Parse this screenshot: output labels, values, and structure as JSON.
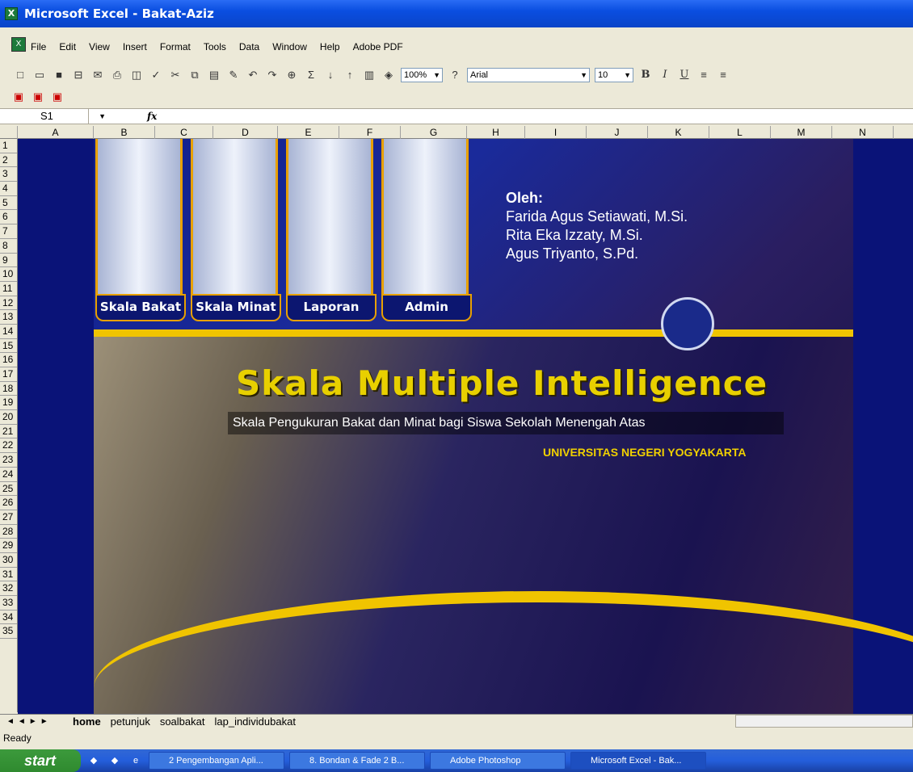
{
  "window": {
    "title": "Microsoft Excel - Bakat-Aziz"
  },
  "menu": [
    "File",
    "Edit",
    "View",
    "Insert",
    "Format",
    "Tools",
    "Data",
    "Window",
    "Help",
    "Adobe PDF"
  ],
  "toolbar": {
    "zoom": "100%",
    "font": "Arial",
    "size": "10",
    "bold": "B",
    "italic": "I",
    "underline": "U",
    "sigma": "Σ"
  },
  "formula_bar": {
    "cell": "S1",
    "fx": "fx",
    "value": ""
  },
  "columns": [
    "A",
    "B",
    "C",
    "D",
    "E",
    "F",
    "G",
    "H",
    "I",
    "J",
    "K",
    "L",
    "M",
    "N"
  ],
  "rows": [
    "1",
    "2",
    "3",
    "4",
    "5",
    "6",
    "7",
    "8",
    "9",
    "10",
    "11",
    "12",
    "13",
    "14",
    "15",
    "16",
    "17",
    "18",
    "19",
    "20",
    "21",
    "22",
    "23",
    "24",
    "25",
    "26",
    "27",
    "28",
    "29",
    "30",
    "31",
    "32",
    "33",
    "34",
    "35"
  ],
  "banner": {
    "tiles": [
      "Skala Bakat",
      "Skala Minat",
      "Laporan",
      "Admin"
    ],
    "oleh": "Oleh:",
    "authors": [
      "Farida Agus Setiawati, M.Si.",
      "Rita Eka Izzaty, M.Si.",
      "Agus Triyanto, S.Pd."
    ],
    "title": "Skala Multiple Intelligence",
    "subtitle": "Skala Pengukuran Bakat dan Minat bagi Siswa Sekolah Menengah Atas",
    "university": "UNIVERSITAS NEGERI YOGYAKARTA"
  },
  "sheet_tabs": [
    "home",
    "petunjuk",
    "soalbakat",
    "lap_individubakat"
  ],
  "status": "Ready",
  "taskbar": {
    "start": "start",
    "tasks": [
      "2 Pengembangan Apli...",
      "8. Bondan & Fade 2 B...",
      "Adobe Photoshop",
      "Microsoft Excel - Bak..."
    ]
  }
}
